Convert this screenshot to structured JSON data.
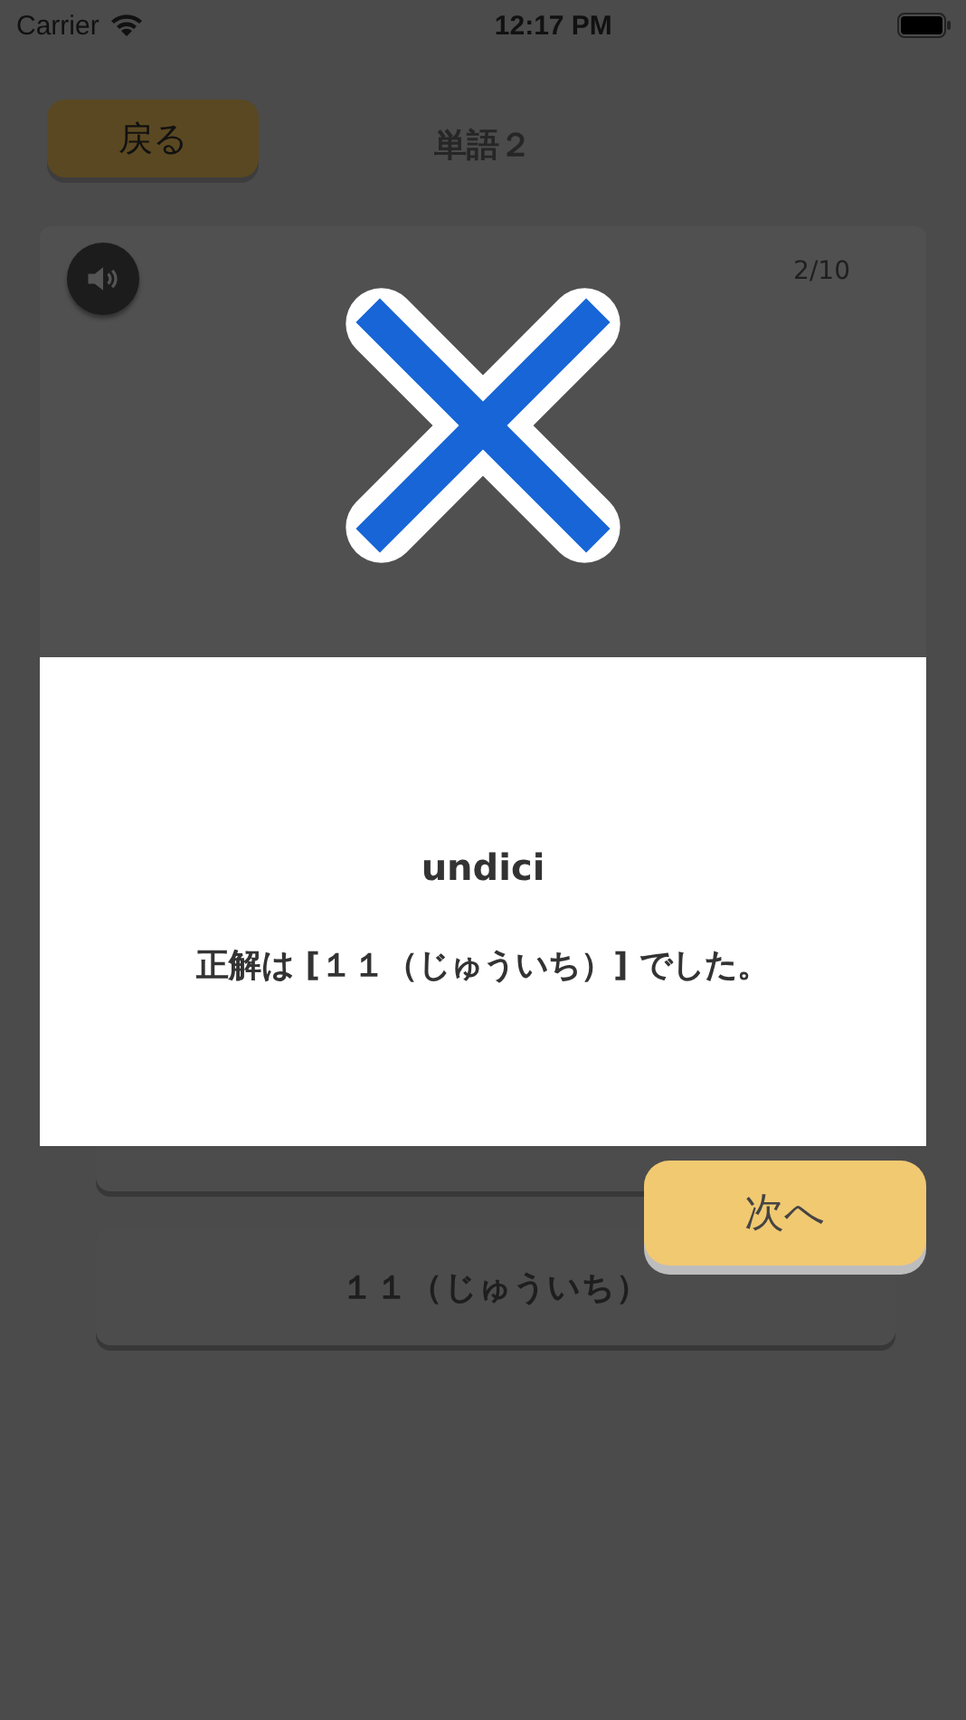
{
  "status_bar": {
    "carrier": "Carrier",
    "time": "12:17 PM"
  },
  "header": {
    "back_button": "戻る",
    "title": "単語２"
  },
  "card": {
    "progress": "2/10"
  },
  "answers": [
    {
      "label": "１１（じゅういち）"
    }
  ],
  "result": {
    "correct": false,
    "word": "undici",
    "message": "正解は [１１（じゅういち）] でした。"
  },
  "next_button": "次へ"
}
